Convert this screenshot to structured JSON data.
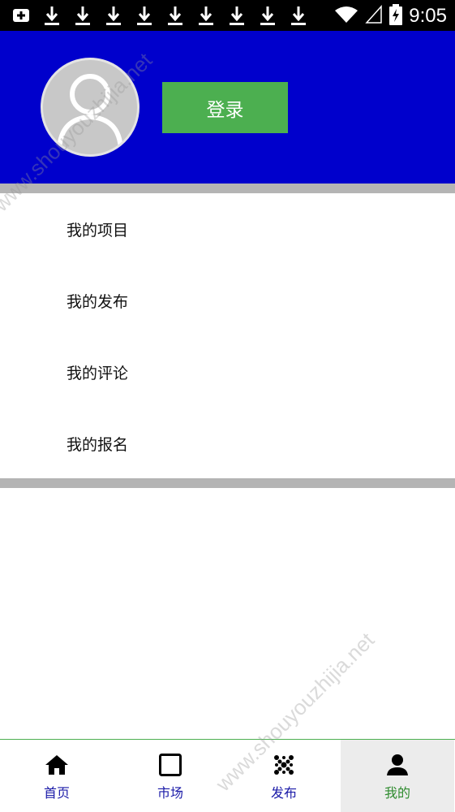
{
  "status_bar": {
    "time": "9:05",
    "notification_icons": [
      "app-notification-icon",
      "download-icon",
      "download-icon",
      "download-icon",
      "download-icon",
      "download-icon",
      "download-icon",
      "download-icon",
      "download-icon",
      "download-icon"
    ],
    "system_icons": [
      "wifi-icon",
      "signal-icon",
      "battery-charging-icon"
    ]
  },
  "header": {
    "background_color": "#0000cc",
    "avatar_icon": "user-avatar-icon",
    "login_label": "登录",
    "login_color": "#4caf50"
  },
  "menu": {
    "items": [
      {
        "label": "我的项目"
      },
      {
        "label": "我的发布"
      },
      {
        "label": "我的评论"
      },
      {
        "label": "我的报名"
      }
    ]
  },
  "bottom_nav": {
    "items": [
      {
        "label": "首页",
        "icon": "home-icon"
      },
      {
        "label": "市场",
        "icon": "square-icon"
      },
      {
        "label": "发布",
        "icon": "dots-grid-icon"
      },
      {
        "label": "我的",
        "icon": "person-icon",
        "active": true
      }
    ],
    "active_color": "#2e8b2e",
    "inactive_color": "#1a1aa8"
  },
  "watermark": {
    "text": "www.shouyouzhijia.net"
  }
}
